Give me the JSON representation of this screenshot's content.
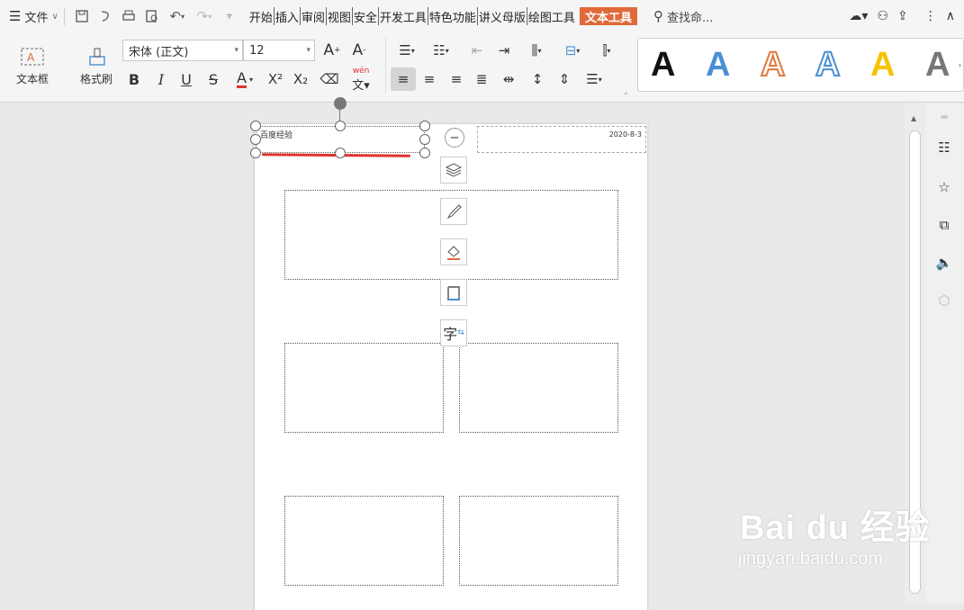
{
  "titlebar": {
    "menu_label": "文件",
    "tabs": [
      "开始",
      "插入",
      "审阅",
      "视图",
      "安全",
      "开发工具",
      "特色功能",
      "讲义母版",
      "绘图工具"
    ],
    "active_tab": "文本工具",
    "search_label": "查找命..."
  },
  "ribbon": {
    "textbox_label": "文本框",
    "format_painter_label": "格式刷",
    "font_name": "宋体 (正文)",
    "font_size": "12",
    "bold": "B",
    "italic": "I",
    "underline": "U",
    "strike": "S",
    "font_color": "A",
    "superscript": "X²",
    "subscript": "X₂",
    "phonetic": "wén",
    "wordart_letter": "A"
  },
  "page": {
    "header_text": "百度经验",
    "date_text": "2020-8-3"
  },
  "float_tools": {
    "char_label": "字"
  },
  "watermark": {
    "brand": "Bai du 经验",
    "url": "jingyan.baidu.com"
  },
  "colors": {
    "active_tab_bg": "#e06a3b",
    "underline_red": "#e0332f",
    "accent_blue": "#4a8fd4"
  }
}
